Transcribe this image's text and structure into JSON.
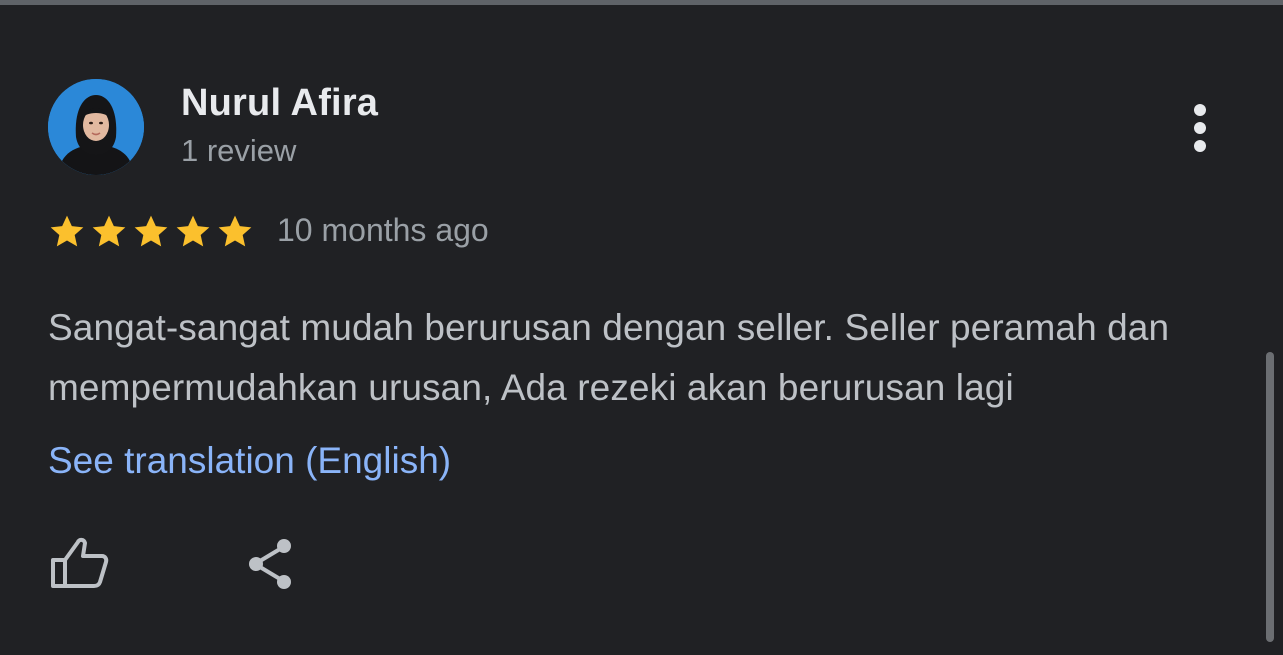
{
  "review": {
    "reviewer_name": "Nurul Afira",
    "review_count": "1 review",
    "rating": 5,
    "rating_max": 5,
    "date": "10 months ago",
    "text": "Sangat-sangat mudah berurusan dengan seller. Seller peramah dan mempermudahkan urusan, Ada rezeki akan berurusan lagi",
    "translation_link": "See translation (English)"
  },
  "icons": {
    "avatar": "avatar",
    "more": "more-vert-icon",
    "star": "star-icon",
    "like": "thumb-up-icon",
    "share": "share-icon"
  },
  "colors": {
    "background": "#202124",
    "star": "#fbc02d",
    "link": "#8ab4f8",
    "name": "#e8eaed",
    "secondary": "#9aa0a6",
    "body_text": "#bdc1c6"
  }
}
